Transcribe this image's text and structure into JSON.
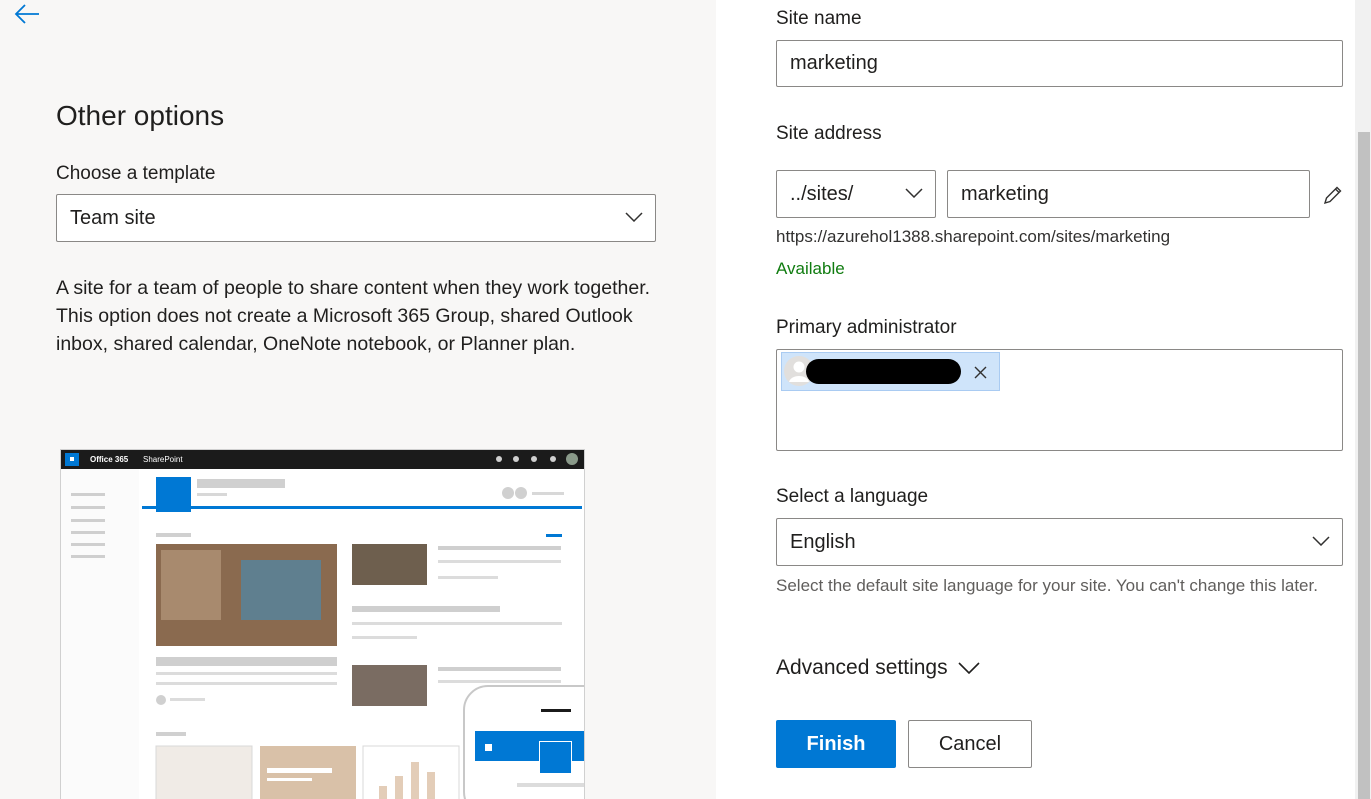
{
  "left": {
    "heading": "Other options",
    "template_label": "Choose a template",
    "template_value": "Team site",
    "description": "A site for a team of people to share content when they work together. This option does not create a Microsoft 365 Group, shared Outlook inbox, shared calendar, OneNote notebook, or Planner plan.",
    "preview": {
      "brand": "Office 365",
      "app": "SharePoint"
    }
  },
  "form": {
    "site_name_label": "Site name",
    "site_name_value": "marketing",
    "site_address_label": "Site address",
    "site_address_prefix": "../sites/",
    "site_address_value": "marketing",
    "site_url": "https://azurehol1388.sharepoint.com/sites/marketing",
    "availability": "Available",
    "admin_label": "Primary administrator",
    "language_label": "Select a language",
    "language_value": "English",
    "language_hint": "Select the default site language for your site. You can't change this later.",
    "advanced_label": "Advanced settings",
    "finish_label": "Finish",
    "cancel_label": "Cancel"
  },
  "colors": {
    "primary": "#0078d4",
    "available": "#107c10",
    "persona_bg": "#cfe4fa"
  }
}
